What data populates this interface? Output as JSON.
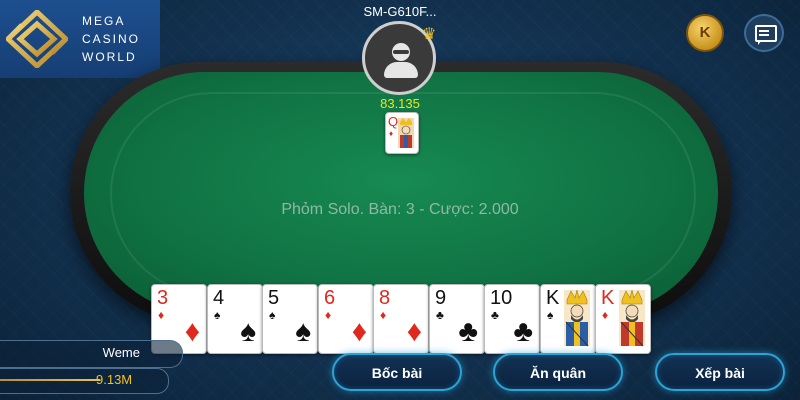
{
  "brand": {
    "lines": [
      "MEGA",
      "CASINO",
      "WORLD"
    ]
  },
  "opponent": {
    "name": "SM-G610F...",
    "chips": "83.135",
    "card": {
      "rank": "Q",
      "suit": "♦",
      "color": "red"
    }
  },
  "table": {
    "info": "Phỏm Solo. Bàn: 3 - Cược: 2.000"
  },
  "hand": [
    {
      "rank": "3",
      "suit": "♦",
      "color": "red"
    },
    {
      "rank": "4",
      "suit": "♠",
      "color": "black"
    },
    {
      "rank": "5",
      "suit": "♠",
      "color": "black"
    },
    {
      "rank": "6",
      "suit": "♦",
      "color": "red"
    },
    {
      "rank": "8",
      "suit": "♦",
      "color": "red"
    },
    {
      "rank": "9",
      "suit": "♣",
      "color": "black"
    },
    {
      "rank": "10",
      "suit": "♣",
      "color": "black"
    },
    {
      "rank": "K",
      "suit": "♠",
      "color": "black"
    },
    {
      "rank": "K",
      "suit": "♦",
      "color": "red"
    }
  ],
  "player": {
    "name": "Weme",
    "money": "9.13M"
  },
  "actions": {
    "draw": "Bốc bài",
    "eat": "Ăn quân",
    "arrange": "Xếp bài"
  },
  "top_icons": {
    "coin_label": "K",
    "coin_icon": "coin-icon",
    "chat_icon": "chat-icon"
  },
  "colors": {
    "felt": "#107343",
    "button_border": "#2aa4d6",
    "chips_text": "#e7e91a",
    "money_text": "#f2c21c"
  }
}
